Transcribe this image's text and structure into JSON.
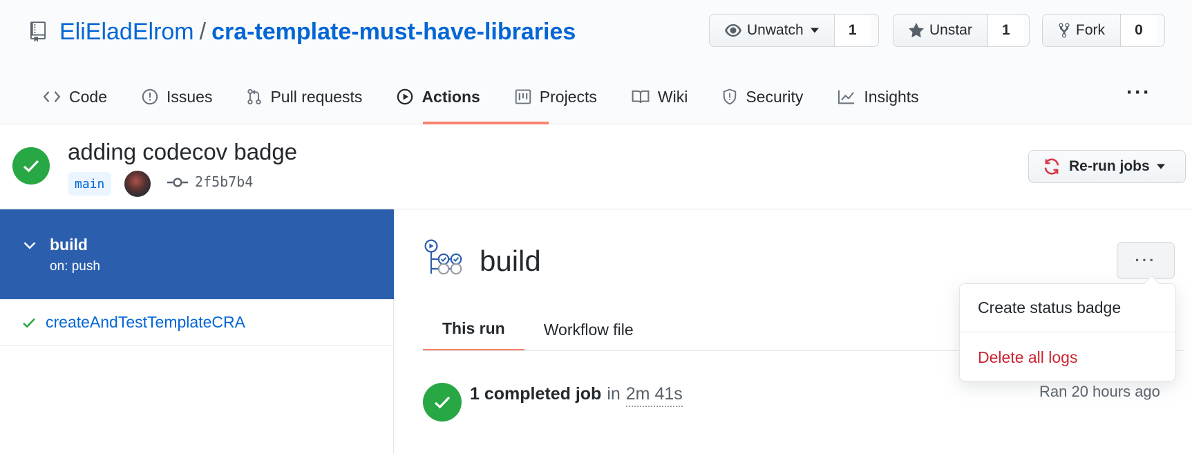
{
  "repo": {
    "owner": "EliEladElrom",
    "separator": "/",
    "name": "cra-template-must-have-libraries"
  },
  "social": {
    "watch_label": "Unwatch",
    "watch_count": "1",
    "star_label": "Unstar",
    "star_count": "1",
    "fork_label": "Fork",
    "fork_count": "0"
  },
  "tabs": [
    {
      "label": "Code",
      "icon": "code-icon"
    },
    {
      "label": "Issues",
      "icon": "issue-opened-icon"
    },
    {
      "label": "Pull requests",
      "icon": "git-pull-request-icon"
    },
    {
      "label": "Actions",
      "icon": "play-icon",
      "active": true
    },
    {
      "label": "Projects",
      "icon": "project-icon"
    },
    {
      "label": "Wiki",
      "icon": "book-icon"
    },
    {
      "label": "Security",
      "icon": "shield-icon"
    },
    {
      "label": "Insights",
      "icon": "graph-icon"
    }
  ],
  "run": {
    "title": "adding codecov badge",
    "branch": "main",
    "sha": "2f5b7b4",
    "rerun_label": "Re-run jobs"
  },
  "sidebar": {
    "workflow_name": "build",
    "trigger": "on: push",
    "jobs": [
      {
        "label": "createAndTestTemplateCRA",
        "status": "success"
      }
    ]
  },
  "main": {
    "title": "build",
    "tabs": [
      "This run",
      "Workflow file"
    ],
    "summary_jobs": "1 completed job",
    "summary_in": "in",
    "summary_duration": "2m 41s",
    "ran": "Ran 20 hours ago"
  },
  "menu": {
    "items": [
      "Create status badge",
      "Delete all logs"
    ]
  },
  "colors": {
    "accent": "#0366d6",
    "success": "#28a745",
    "selected_bg": "#2b5fae",
    "tab_underline": "#f9826c",
    "danger": "#cb2431"
  }
}
